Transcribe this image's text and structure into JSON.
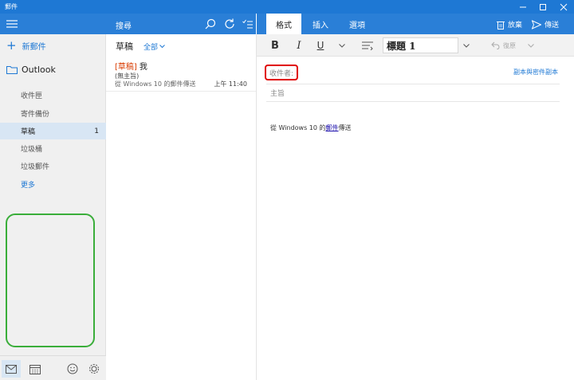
{
  "app": {
    "title": "郵件"
  },
  "nav": {
    "new_mail_label": "新郵件",
    "account_label": "Outlook",
    "folders": [
      {
        "label": "收件匣",
        "count": ""
      },
      {
        "label": "寄件備份",
        "count": ""
      },
      {
        "label": "草稿",
        "count": "1",
        "active": true
      },
      {
        "label": "垃圾桶",
        "count": ""
      },
      {
        "label": "垃圾郵件",
        "count": ""
      }
    ],
    "more_label": "更多"
  },
  "list": {
    "search_label": "搜尋",
    "folder_title": "草稿",
    "filter_label": "全部",
    "messages": [
      {
        "draft_tag": "[草稿]",
        "sender": "我",
        "subject": "(無主旨)",
        "preview": "從 Windows 10 的郵件傳送",
        "time": "上午 11:40"
      }
    ]
  },
  "compose": {
    "tabs": [
      "格式",
      "插入",
      "選項"
    ],
    "discard_label": "放棄",
    "send_label": "傳送",
    "toolbar": {
      "bold": "B",
      "italic": "I",
      "underline": "U",
      "style_value": "標題 1",
      "undo_label": "復原"
    },
    "to_label": "收件者:",
    "cc_bcc_label": "副本與密件副本",
    "subject_placeholder": "主旨",
    "body_prefix": "從 Windows 10 的",
    "body_link": "郵件",
    "body_suffix": "傳送"
  },
  "colors": {
    "accent": "#1e78d4",
    "header_blue": "#2a7fd7",
    "draft_tag": "#d83b01",
    "highlight_box": "#e00000",
    "green_box": "#3aae3a",
    "link": "#1a0dab"
  }
}
